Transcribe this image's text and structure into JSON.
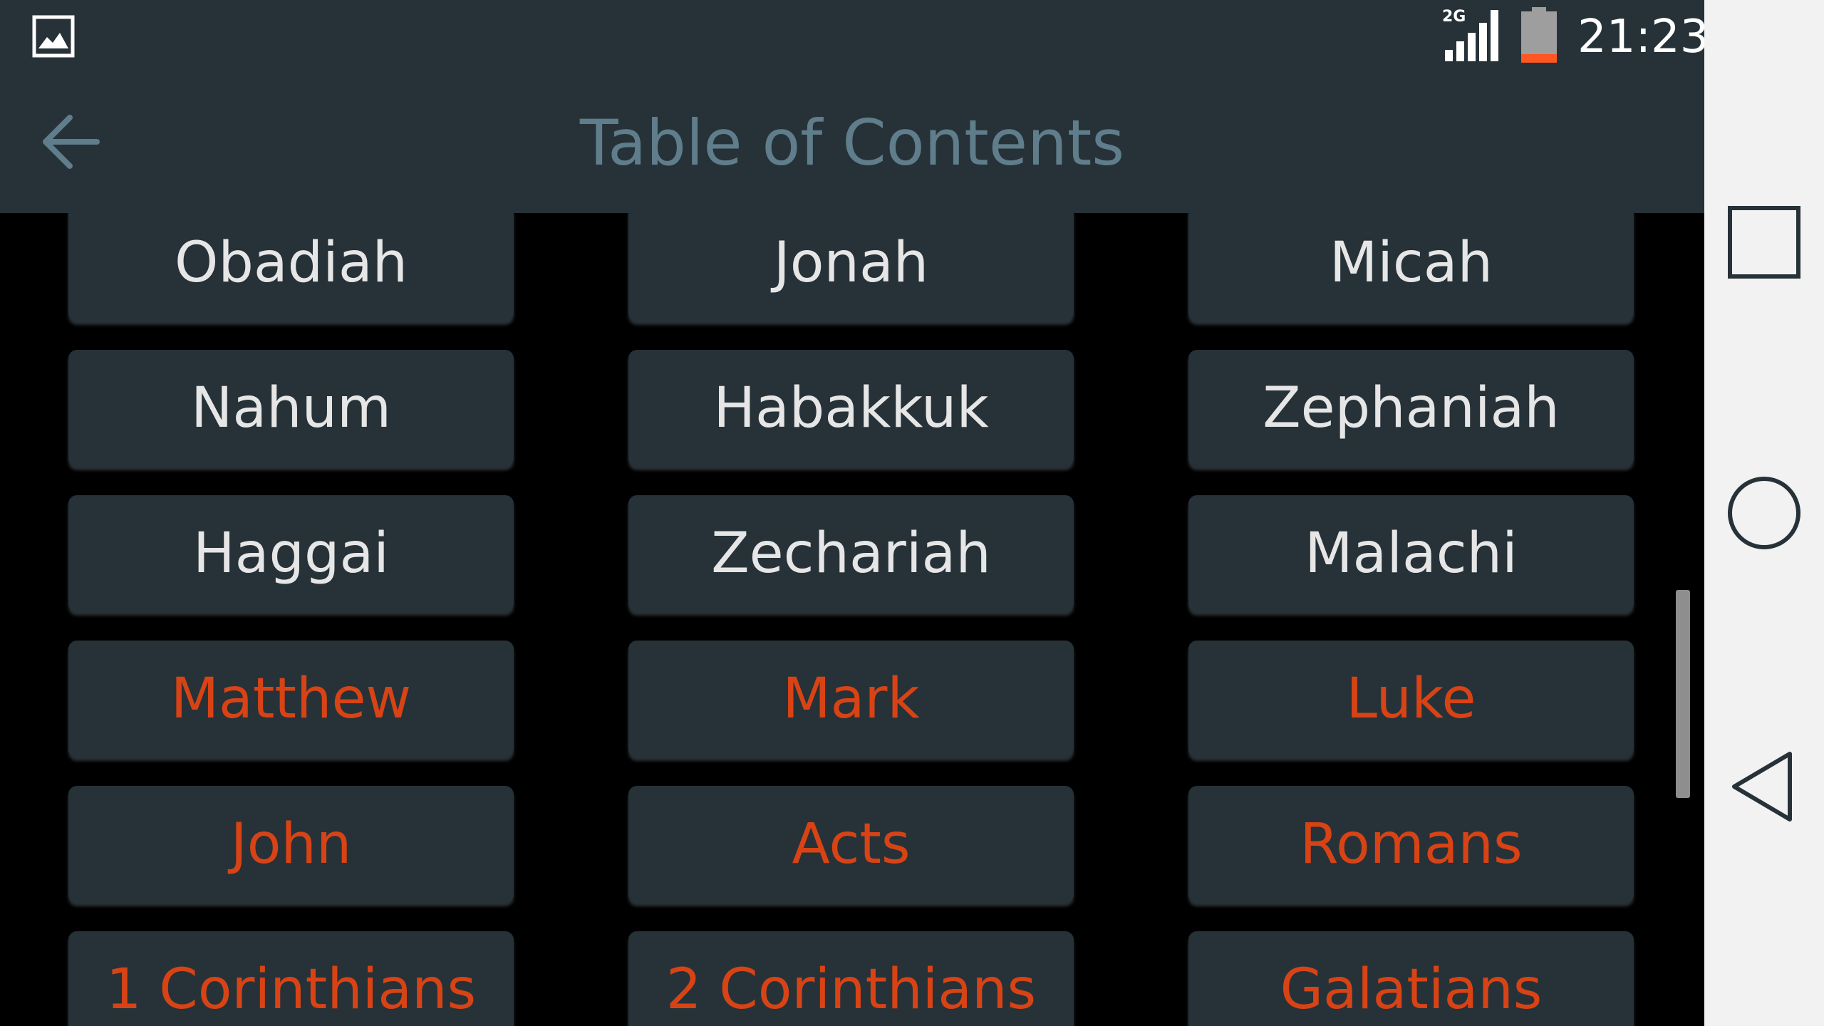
{
  "status_bar": {
    "time": "21:23",
    "network_type": "2G",
    "notification_icon": "gallery-icon",
    "battery_color": "#ff5722"
  },
  "toolbar": {
    "title": "Table of Contents",
    "back_icon": "arrow-left-icon"
  },
  "colors": {
    "surface": "#263238",
    "old_testament_text": "#e6e6e6",
    "new_testament_text": "#d84315",
    "title_text": "#607d8b"
  },
  "books": [
    {
      "name": "Obadiah",
      "testament": "ot"
    },
    {
      "name": "Jonah",
      "testament": "ot"
    },
    {
      "name": "Micah",
      "testament": "ot"
    },
    {
      "name": "Nahum",
      "testament": "ot"
    },
    {
      "name": "Habakkuk",
      "testament": "ot"
    },
    {
      "name": "Zephaniah",
      "testament": "ot"
    },
    {
      "name": "Haggai",
      "testament": "ot"
    },
    {
      "name": "Zechariah",
      "testament": "ot"
    },
    {
      "name": "Malachi",
      "testament": "ot"
    },
    {
      "name": "Matthew",
      "testament": "nt"
    },
    {
      "name": "Mark",
      "testament": "nt"
    },
    {
      "name": "Luke",
      "testament": "nt"
    },
    {
      "name": "John",
      "testament": "nt"
    },
    {
      "name": "Acts",
      "testament": "nt"
    },
    {
      "name": "Romans",
      "testament": "nt"
    },
    {
      "name": "1 Corinthians",
      "testament": "nt"
    },
    {
      "name": "2 Corinthians",
      "testament": "nt"
    },
    {
      "name": "Galatians",
      "testament": "nt"
    }
  ],
  "nav_bar": {
    "recents_icon": "square-icon",
    "home_icon": "circle-icon",
    "back_icon": "triangle-back-icon"
  }
}
